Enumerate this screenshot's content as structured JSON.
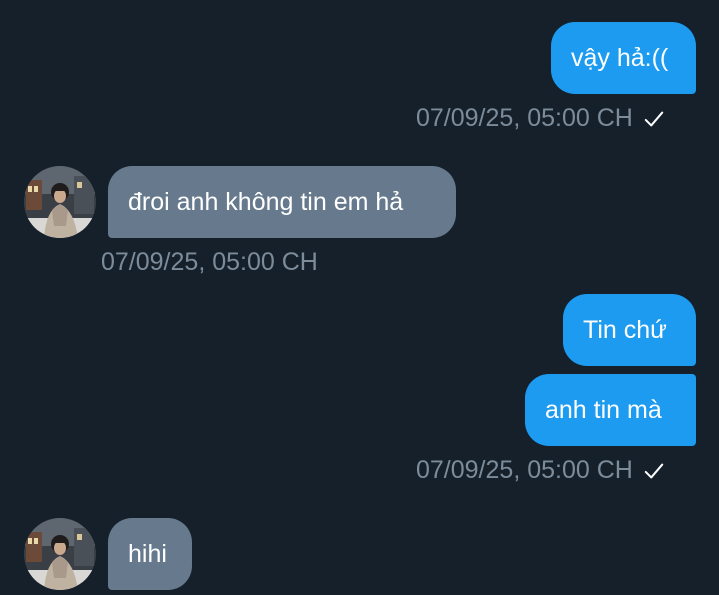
{
  "messages": [
    {
      "direction": "out",
      "text": "vậy hả:(("
    },
    {
      "direction": "out_meta",
      "timestamp": "07/09/25, 05:00 CH",
      "status_icon": "check-icon"
    },
    {
      "direction": "in",
      "text": "đroi anh không tin em hả"
    },
    {
      "direction": "in_meta",
      "timestamp": "07/09/25, 05:00 CH"
    },
    {
      "direction": "out",
      "text": "Tin chứ"
    },
    {
      "direction": "out",
      "text": "anh tin mà"
    },
    {
      "direction": "out_meta",
      "timestamp": "07/09/25, 05:00 CH",
      "status_icon": "check-icon"
    },
    {
      "direction": "in",
      "text": "hihi"
    }
  ],
  "colors": {
    "background": "#15202b",
    "outgoing_bubble": "#1d9bf0",
    "incoming_bubble": "#66798d",
    "timestamp_text": "#7d8c9a",
    "check_icon": "#ffffff"
  }
}
